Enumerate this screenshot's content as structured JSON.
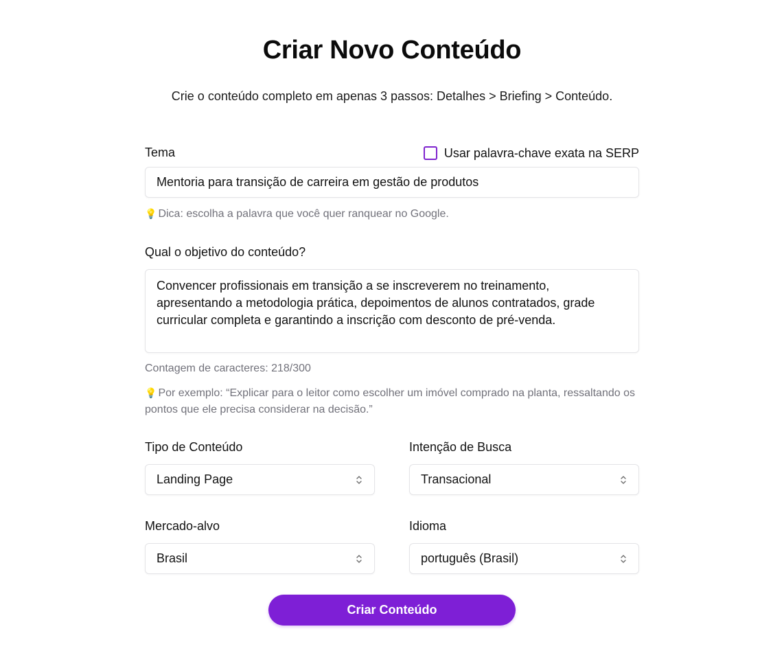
{
  "header": {
    "title": "Criar Novo Conteúdo",
    "subtitle": "Crie o conteúdo completo em apenas 3 passos: Detalhes > Briefing > Conteúdo."
  },
  "theme": {
    "label": "Tema",
    "exact_keyword_label": "Usar palavra-chave exata na SERP",
    "exact_keyword_checked": false,
    "value": "Mentoria para transição de carreira em gestão de produtos",
    "hint_icon": "lightbulb-icon",
    "hint": "Dica: escolha a palavra que você quer ranquear no Google."
  },
  "objective": {
    "label": "Qual o objetivo do conteúdo?",
    "value": "Convencer profissionais em transição a se inscreverem no treinamento, apresentando a metodologia prática, depoimentos de alunos contratados, grade curricular completa e garantindo a inscrição com desconto de pré-venda.",
    "char_count": "Contagem de caracteres: 218/300",
    "hint_icon": "lightbulb-icon",
    "example": "Por exemplo: “Explicar para o leitor como escolher um imóvel comprado na planta, ressaltando os pontos que ele precisa considerar na decisão.”"
  },
  "content_type": {
    "label": "Tipo de Conteúdo",
    "value": "Landing Page"
  },
  "search_intent": {
    "label": "Intenção de Busca",
    "value": "Transacional"
  },
  "target_market": {
    "label": "Mercado-alvo",
    "value": "Brasil"
  },
  "language": {
    "label": "Idioma",
    "value": "português (Brasil)"
  },
  "submit": {
    "label": "Criar Conteúdo"
  },
  "colors": {
    "accent": "#7e1fd6",
    "border": "#e4e4e7",
    "muted": "#71717a"
  }
}
